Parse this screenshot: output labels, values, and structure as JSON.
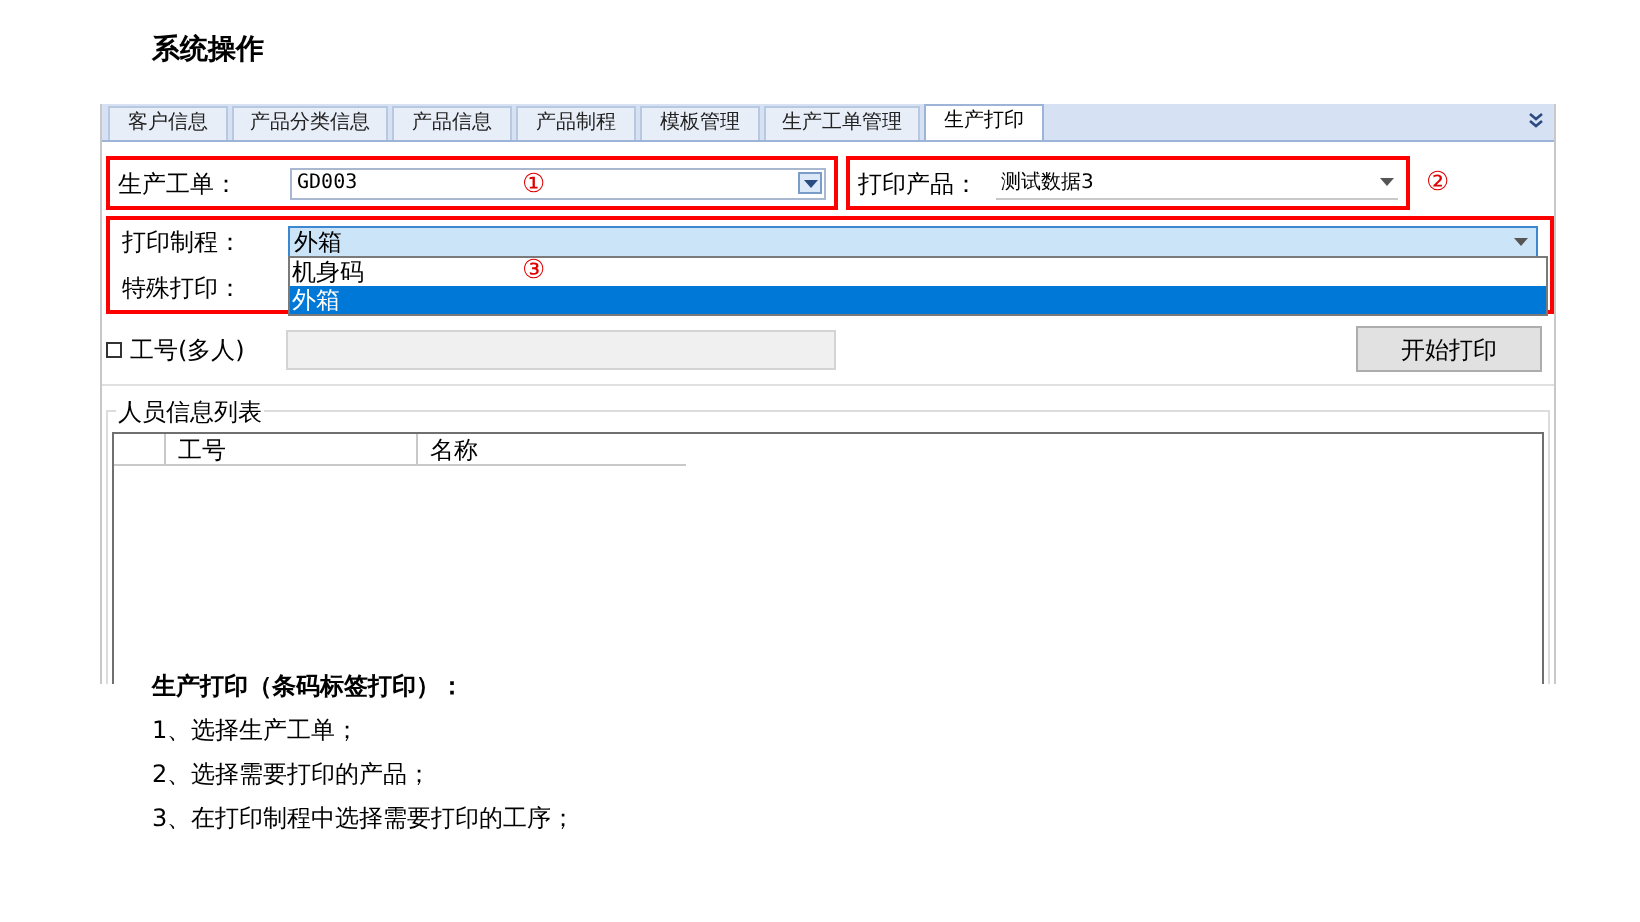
{
  "heading": "系统操作",
  "tabs": [
    {
      "label": "客户信息",
      "selected": false
    },
    {
      "label": "产品分类信息",
      "selected": false
    },
    {
      "label": "产品信息",
      "selected": false
    },
    {
      "label": "产品制程",
      "selected": false
    },
    {
      "label": "模板管理",
      "selected": false
    },
    {
      "label": "生产工单管理",
      "selected": false
    },
    {
      "label": "生产打印",
      "selected": true
    }
  ],
  "form": {
    "work_order": {
      "label": "生产工单：",
      "value": "GD003",
      "marker": "①"
    },
    "product": {
      "label": "打印产品：",
      "value": "测试数据3",
      "marker": "②"
    },
    "process": {
      "label": "打印制程：",
      "value": "外箱",
      "marker": "③",
      "expanded": true,
      "options": [
        {
          "label": "机身码",
          "selected": false
        },
        {
          "label": "外箱",
          "selected": true
        }
      ]
    },
    "special": {
      "label": "特殊打印："
    },
    "employee": {
      "label": "工号(多人)",
      "checked": false
    },
    "print_button": "开始打印"
  },
  "staff_list": {
    "title": "人员信息列表",
    "columns": [
      "工号",
      "名称"
    ]
  },
  "notes": {
    "title": "生产打印（条码标签打印）：",
    "steps": [
      "1、选择生产工单；",
      "2、选择需要打印的产品；",
      "3、在打印制程中选择需要打印的工序；"
    ]
  }
}
